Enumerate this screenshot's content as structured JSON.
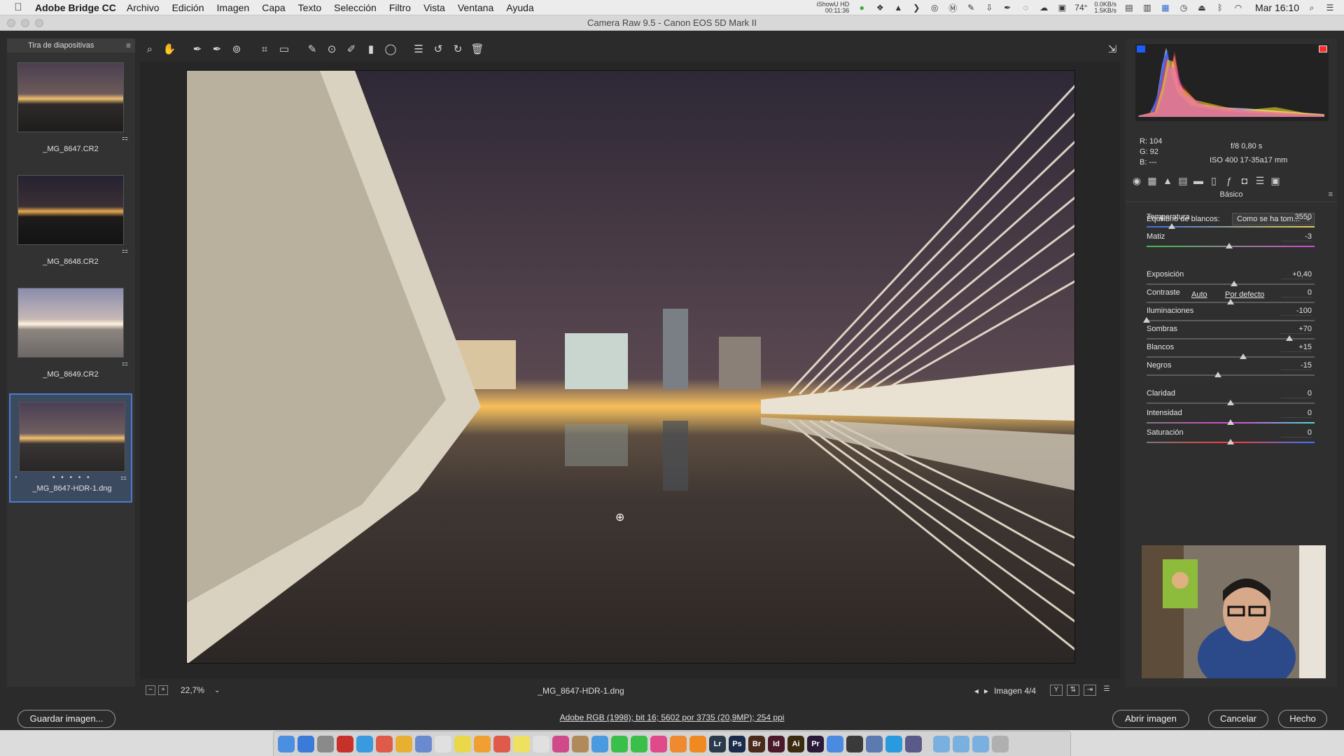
{
  "menubar": {
    "apple": "",
    "app_name": "Adobe Bridge CC",
    "menus": [
      "Archivo",
      "Edición",
      "Imagen",
      "Capa",
      "Texto",
      "Selección",
      "Filtro",
      "Vista",
      "Ventana",
      "Ayuda"
    ],
    "status": {
      "showhd_line1": "iShowU HD",
      "showhd_line2": "00:11:36",
      "temperature": "74°",
      "net_up": "0.0KB/s",
      "net_down": "1.5KB/s",
      "clock": "Mar 16:10"
    }
  },
  "window": {
    "title": "Camera Raw 9.5  -  Canon EOS 5D Mark II"
  },
  "filmstrip": {
    "title": "Tira de diapositivas",
    "items": [
      {
        "name": "_MG_8647.CR2"
      },
      {
        "name": "_MG_8648.CR2"
      },
      {
        "name": "_MG_8649.CR2"
      },
      {
        "name": "_MG_8647-HDR-1.dng"
      }
    ],
    "selected_index": 3,
    "dots": "• • • • •"
  },
  "toolbar": {
    "tools": [
      "zoom-icon",
      "hand-icon",
      "white-balance-icon",
      "color-sampler-icon",
      "targeted-adjust-icon",
      "crop-icon",
      "straighten-icon",
      "spot-removal-icon",
      "redeye-icon",
      "adjustment-brush-icon",
      "graduated-filter-icon",
      "radial-filter-icon",
      "preferences-icon",
      "rotate-left-icon",
      "rotate-right-icon",
      "trash-icon"
    ],
    "tool_glyphs": [
      "⌕",
      "✋",
      "✒",
      "✒",
      "⊚",
      "⌗",
      "▭",
      "✎",
      "⊙",
      "✐",
      "▮",
      "◯",
      "☰",
      "↺",
      "↻",
      "🗑"
    ],
    "fullscreen_glyph": "⇲"
  },
  "preview": {
    "zoom": "22,7%",
    "filename": "_MG_8647-HDR-1.dng",
    "image_counter": "Imagen 4/4",
    "cursor_glyph": "⊕"
  },
  "histogram": {
    "info_lines": {
      "r": "R:  104",
      "g": "G:   92",
      "b": "B:   ---"
    },
    "aperture_speed": "f/8      0,80 s",
    "iso_lens": "ISO 400    17-35a17 mm"
  },
  "panel": {
    "title": "Básico",
    "white_balance": {
      "label": "Equilibrio de blancos:",
      "value": "Como se ha tom..."
    },
    "auto_label": "Auto",
    "default_label": "Por defecto",
    "sliders": [
      {
        "label": "Temperatura",
        "value": "3550",
        "position": 0.15
      },
      {
        "label": "Matiz",
        "value": "-3",
        "position": 0.49
      },
      {
        "label": "Exposición",
        "value": "+0,40",
        "position": 0.52
      },
      {
        "label": "Contraste",
        "value": "0",
        "position": 0.5
      },
      {
        "label": "Iluminaciones",
        "value": "-100",
        "position": 0.0
      },
      {
        "label": "Sombras",
        "value": "+70",
        "position": 0.85
      },
      {
        "label": "Blancos",
        "value": "+15",
        "position": 0.575
      },
      {
        "label": "Negros",
        "value": "-15",
        "position": 0.425
      },
      {
        "label": "Claridad",
        "value": "0",
        "position": 0.5
      },
      {
        "label": "Intensidad",
        "value": "0",
        "position": 0.5
      },
      {
        "label": "Saturación",
        "value": "0",
        "position": 0.5
      }
    ]
  },
  "footer": {
    "save_label": "Guardar imagen...",
    "workflow": "Adobe RGB (1998); bit 16; 5602 por 3735 (20,9MP); 254 ppi",
    "open_label": "Abrir imagen",
    "cancel_label": "Cancelar",
    "done_label": "Hecho"
  },
  "dock": {
    "apps": [
      "Finder",
      "App Store",
      "Launchpad",
      "FileZilla",
      "Safari",
      "Calendar",
      "Chrome",
      "Preview",
      "TextEdit",
      "Notes",
      "Photos",
      "Calendar",
      "Stickies",
      "Reminders",
      "Photos",
      "Contacts",
      "Mail",
      "FaceTime",
      "Messages",
      "iTunes",
      "iBooks",
      "VLC",
      "Lightroom",
      "Photoshop",
      "Bridge",
      "InDesign",
      "Illustrator",
      "Premiere",
      "Mail",
      "Other",
      "Other",
      "Skype",
      "Other",
      "Folder",
      "Folder",
      "Folder",
      "Trash"
    ],
    "labels": {
      "lr": "Lr",
      "ps": "Ps",
      "br": "Br",
      "id": "Id",
      "ai": "Ai",
      "pr": "Pr"
    }
  }
}
